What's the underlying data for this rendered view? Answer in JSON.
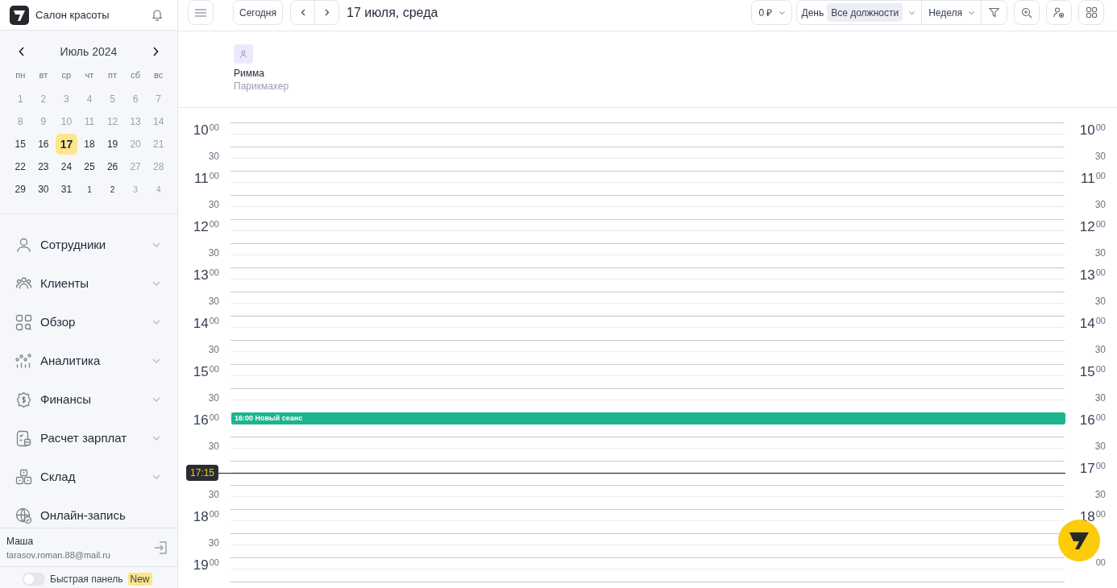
{
  "app": {
    "title": "Салон красоты"
  },
  "mini_calendar": {
    "month": "Июль 2024",
    "weekdays": [
      "пн",
      "вт",
      "ср",
      "чт",
      "пт",
      "сб",
      "вс"
    ],
    "days": [
      {
        "label": "1",
        "muted": true,
        "other_month": false,
        "selected": false
      },
      {
        "label": "2",
        "muted": true,
        "other_month": false,
        "selected": false
      },
      {
        "label": "3",
        "muted": true,
        "other_month": false,
        "selected": false
      },
      {
        "label": "4",
        "muted": true,
        "other_month": false,
        "selected": false
      },
      {
        "label": "5",
        "muted": true,
        "other_month": false,
        "selected": false
      },
      {
        "label": "6",
        "muted": true,
        "other_month": false,
        "selected": false
      },
      {
        "label": "7",
        "muted": true,
        "other_month": false,
        "selected": false
      },
      {
        "label": "8",
        "muted": true,
        "other_month": false,
        "selected": false
      },
      {
        "label": "9",
        "muted": true,
        "other_month": false,
        "selected": false
      },
      {
        "label": "10",
        "muted": true,
        "other_month": false,
        "selected": false
      },
      {
        "label": "11",
        "muted": true,
        "other_month": false,
        "selected": false
      },
      {
        "label": "12",
        "muted": true,
        "other_month": false,
        "selected": false
      },
      {
        "label": "13",
        "muted": true,
        "other_month": false,
        "selected": false
      },
      {
        "label": "14",
        "muted": true,
        "other_month": false,
        "selected": false
      },
      {
        "label": "15",
        "muted": false,
        "other_month": false,
        "selected": false
      },
      {
        "label": "16",
        "muted": false,
        "other_month": false,
        "selected": false
      },
      {
        "label": "17",
        "muted": false,
        "other_month": false,
        "selected": true
      },
      {
        "label": "18",
        "muted": false,
        "other_month": false,
        "selected": false
      },
      {
        "label": "19",
        "muted": false,
        "other_month": false,
        "selected": false
      },
      {
        "label": "20",
        "muted": true,
        "other_month": false,
        "selected": false
      },
      {
        "label": "21",
        "muted": true,
        "other_month": false,
        "selected": false
      },
      {
        "label": "22",
        "muted": false,
        "other_month": false,
        "selected": false
      },
      {
        "label": "23",
        "muted": false,
        "other_month": false,
        "selected": false
      },
      {
        "label": "24",
        "muted": false,
        "other_month": false,
        "selected": false
      },
      {
        "label": "25",
        "muted": false,
        "other_month": false,
        "selected": false
      },
      {
        "label": "26",
        "muted": false,
        "other_month": false,
        "selected": false
      },
      {
        "label": "27",
        "muted": true,
        "other_month": false,
        "selected": false
      },
      {
        "label": "28",
        "muted": true,
        "other_month": false,
        "selected": false
      },
      {
        "label": "29",
        "muted": false,
        "other_month": false,
        "selected": false
      },
      {
        "label": "30",
        "muted": false,
        "other_month": false,
        "selected": false
      },
      {
        "label": "31",
        "muted": false,
        "other_month": false,
        "selected": false
      },
      {
        "label": "1",
        "muted": false,
        "other_month": true,
        "selected": false
      },
      {
        "label": "2",
        "muted": false,
        "other_month": true,
        "selected": false
      },
      {
        "label": "3",
        "muted": true,
        "other_month": true,
        "selected": false
      },
      {
        "label": "4",
        "muted": true,
        "other_month": true,
        "selected": false
      }
    ]
  },
  "nav": [
    {
      "label": "Сотрудники",
      "expanded": false
    },
    {
      "label": "Клиенты",
      "expanded": false
    },
    {
      "label": "Обзор",
      "expanded": false
    },
    {
      "label": "Аналитика",
      "expanded": false
    },
    {
      "label": "Финансы",
      "expanded": false
    },
    {
      "label": "Расчет зарплат",
      "expanded": false
    },
    {
      "label": "Склад",
      "expanded": false
    },
    {
      "label": "Онлайн-запись"
    }
  ],
  "user": {
    "name": "Маша",
    "email": "tarasov.roman.88@mail.ru"
  },
  "quick_panel": {
    "label": "Быстрая панель",
    "badge": "New",
    "on": false
  },
  "toolbar": {
    "today": "Сегодня",
    "date": "17 июля, среда",
    "revenue": "0 ₽",
    "day": "День",
    "positions": "Все должности",
    "week": "Неделя"
  },
  "staff": [
    {
      "name": "Римма",
      "role": "Парикмахер"
    }
  ],
  "time_rows": [
    {
      "kind": "hour",
      "left": {
        "hour": "10",
        "minutes": "00"
      },
      "right": {
        "hour": "10",
        "minutes": "00"
      }
    },
    {
      "kind": "half",
      "left": {
        "minutes": "30"
      },
      "right": {
        "minutes": "30"
      }
    },
    {
      "kind": "hour",
      "left": {
        "hour": "11",
        "minutes": "00"
      },
      "right": {
        "hour": "11",
        "minutes": "00"
      }
    },
    {
      "kind": "half",
      "left": {
        "minutes": "30"
      },
      "right": {
        "minutes": "30"
      }
    },
    {
      "kind": "hour",
      "left": {
        "hour": "12",
        "minutes": "00"
      },
      "right": {
        "hour": "12",
        "minutes": "00"
      }
    },
    {
      "kind": "half",
      "left": {
        "minutes": "30"
      },
      "right": {
        "minutes": "30"
      }
    },
    {
      "kind": "hour",
      "left": {
        "hour": "13",
        "minutes": "00"
      },
      "right": {
        "hour": "13",
        "minutes": "00"
      }
    },
    {
      "kind": "half",
      "left": {
        "minutes": "30"
      },
      "right": {
        "minutes": "30"
      }
    },
    {
      "kind": "hour",
      "left": {
        "hour": "14",
        "minutes": "00"
      },
      "right": {
        "hour": "14",
        "minutes": "00"
      }
    },
    {
      "kind": "half",
      "left": {
        "minutes": "30"
      },
      "right": {
        "minutes": "30"
      }
    },
    {
      "kind": "hour",
      "left": {
        "hour": "15",
        "minutes": "00"
      },
      "right": {
        "hour": "15",
        "minutes": "00"
      }
    },
    {
      "kind": "half",
      "left": {
        "minutes": "30"
      },
      "right": {
        "minutes": "30"
      }
    },
    {
      "kind": "hour",
      "left": {
        "hour": "16",
        "minutes": "00"
      },
      "right": {
        "hour": "16",
        "minutes": "00"
      }
    },
    {
      "kind": "half",
      "left": {
        "minutes": "30"
      },
      "right": {
        "minutes": "30"
      }
    },
    {
      "kind": "hour",
      "right": {
        "hour": "17",
        "minutes": "00"
      }
    },
    {
      "kind": "half",
      "left": {
        "minutes": "30"
      },
      "right": {
        "minutes": "30"
      }
    },
    {
      "kind": "hour",
      "left": {
        "hour": "18",
        "minutes": "00"
      },
      "right": {
        "hour": "18",
        "minutes": "00"
      }
    },
    {
      "kind": "half",
      "left": {
        "minutes": "30"
      }
    },
    {
      "kind": "hour",
      "left": {
        "hour": "19",
        "minutes": "00"
      },
      "right": {
        "minutes": "00"
      }
    }
  ],
  "events": [
    {
      "time": "16:00",
      "title": "Новый сеанс",
      "color": "#1db58f"
    }
  ],
  "now_time": "17:15"
}
